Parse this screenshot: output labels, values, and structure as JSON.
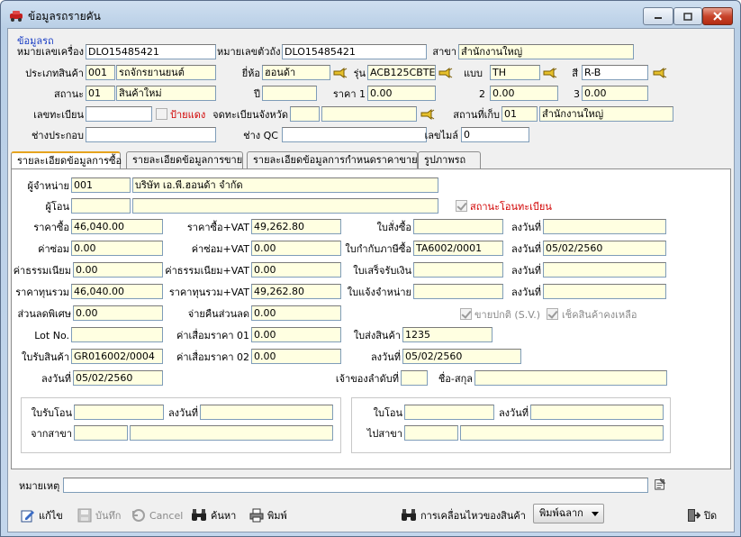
{
  "window": {
    "title": "ข้อมูลรถรายคัน"
  },
  "section_title": "ข้อมูลรถ",
  "header": {
    "engine_no_label": "หมายเลขเครื่อง",
    "engine_no": "DLO15485421",
    "chassis_no_label": "หมายเลขตัวถัง",
    "chassis_no": "DLO15485421",
    "branch_label": "สาขา",
    "branch": "สำนักงานใหญ่",
    "product_type_label": "ประเภทสินค้า",
    "product_type_code": "001",
    "product_type": "รถจักรยานยนต์",
    "brand_label": "ยี่ห้อ",
    "brand": "ฮอนด้า",
    "model_label": "รุ่น",
    "model": "ACB125CBTE",
    "style_label": "แบบ",
    "style": "TH",
    "color_label": "สี",
    "color": "R-B",
    "status_label": "สถานะ",
    "status_code": "01",
    "status": "สินค้าใหม่",
    "year_label": "ปี",
    "year": "",
    "price1_label": "ราคา 1",
    "price1": "0.00",
    "price2_label": "2",
    "price2": "0.00",
    "price3_label": "3",
    "price3": "0.00",
    "reg_no_label": "เลขทะเบียน",
    "reg_no": "",
    "red_plate_label": "ป้ายแดง",
    "reg_province_label": "จดทะเบียนจังหวัด",
    "reg_province_code": "",
    "reg_province": "",
    "storage_label": "สถานที่เก็บ",
    "storage_code": "01",
    "storage": "สำนักงานใหญ่",
    "assembler_label": "ช่างประกอบ",
    "assembler": "",
    "qc_label": "ช่าง QC",
    "qc": "",
    "mileage_label": "เลขไมล์",
    "mileage": "0"
  },
  "tabs": [
    {
      "label": "รายละเอียดข้อมูลการซื้อ",
      "active": true
    },
    {
      "label": "รายละเอียดข้อมูลการขาย",
      "active": false
    },
    {
      "label": "รายละเอียดข้อมูลการกำหนดราคาขาย",
      "active": false
    },
    {
      "label": "รูปภาพรถ",
      "active": false
    }
  ],
  "purchase": {
    "vendor_label": "ผู้จำหน่าย",
    "vendor_code": "001",
    "vendor": "บริษัท เอ.พี.ฮอนด้า จำกัด",
    "transferor_label": "ผู้โอน",
    "transferor_code": "",
    "transferor": "",
    "transfer_status_label": "สถานะโอนทะเบียน",
    "price_label": "ราคาซื้อ",
    "price": "46,040.00",
    "price_vat_label": "ราคาซื้อ+VAT",
    "price_vat": "49,262.80",
    "po_label": "ใบสั่งซื้อ",
    "po": "",
    "po_date_label": "ลงวันที่",
    "po_date": "",
    "repair_label": "ค่าซ่อม",
    "repair": "0.00",
    "repair_vat_label": "ค่าซ่อม+VAT",
    "repair_vat": "0.00",
    "tax_inv_label": "ใบกำกับภาษีซื้อ",
    "tax_inv": "TA6002/0001",
    "tax_inv_date_label": "ลงวันที่",
    "tax_inv_date": "05/02/2560",
    "fee_label": "ค่าธรรมเนียม",
    "fee": "0.00",
    "fee_vat_label": "ค่าธรรมเนียม+VAT",
    "fee_vat": "0.00",
    "receipt_label": "ใบเสร็จรับเงิน",
    "receipt": "",
    "receipt_date_label": "ลงวันที่",
    "receipt_date": "",
    "total_label": "ราคาทุนรวม",
    "total": "46,040.00",
    "total_vat_label": "ราคาทุนรวม+VAT",
    "total_vat": "49,262.80",
    "debit_label": "ใบแจ้งจำหน่าย",
    "debit": "",
    "debit_date_label": "ลงวันที่",
    "debit_date": "",
    "special_disc_label": "ส่วนลดพิเศษ",
    "special_disc": "0.00",
    "refund_disc_label": "จ่ายคืนส่วนลด",
    "refund_disc": "0.00",
    "normal_sale_label": "ขายปกติ (S.V.)",
    "check_stock_label": "เช็คสินค้าคงเหลือ",
    "lot_label": "Lot No.",
    "lot": "",
    "deprec1_label": "ค่าเสื่อมราคา 01",
    "deprec1": "0.00",
    "delivery_label": "ใบส่งสินค้า",
    "delivery": "1235",
    "receive_label": "ใบรับสินค้า",
    "receive": "GR016002/0004",
    "deprec2_label": "ค่าเสื่อมราคา 02",
    "deprec2": "0.00",
    "delivery_date_label": "ลงวันที่",
    "delivery_date": "05/02/2560",
    "receive_date_label": "ลงวันที่",
    "receive_date": "05/02/2560",
    "owner_seq_label": "เจ้าของลำดับที่",
    "owner_seq": "",
    "owner_name_label": "ชื่อ-สกุล",
    "owner_name": "",
    "transfer_in": {
      "doc_label": "ใบรับโอน",
      "doc": "",
      "date_label": "ลงวันที่",
      "date": "",
      "branch_label": "จากสาขา",
      "branch_code": "",
      "branch": ""
    },
    "transfer_out": {
      "doc_label": "ใบโอน",
      "doc": "",
      "date_label": "ลงวันที่",
      "date": "",
      "branch_label": "ไปสาขา",
      "branch_code": "",
      "branch": ""
    }
  },
  "remark_label": "หมายเหตุ",
  "remark": "",
  "toolbar": {
    "edit": "แก้ไข",
    "save": "บันทึก",
    "cancel": "Cancel",
    "search": "ค้นหา",
    "print": "พิมพ์",
    "movement": "การเคลื่อนไหวของสินค้า",
    "print_label": "พิมพ์ฉลาก",
    "close": "ปิด"
  }
}
